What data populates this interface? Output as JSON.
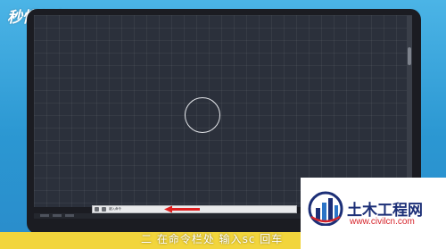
{
  "watermark_top_left": "秒懂视频",
  "command_line": {
    "prompt": "键入命令"
  },
  "subtitle": "二 在命令栏处 输入sc 回车",
  "site_logo": {
    "name": "土木工程网",
    "url": "www.civilcn.com"
  },
  "colors": {
    "canvas": "#2b303b",
    "frame": "#1b1c22",
    "subtitle_bar": "#f2d53c",
    "arrow": "#e02020",
    "logo_blue": "#1c2f77",
    "logo_red": "#d6232a"
  }
}
